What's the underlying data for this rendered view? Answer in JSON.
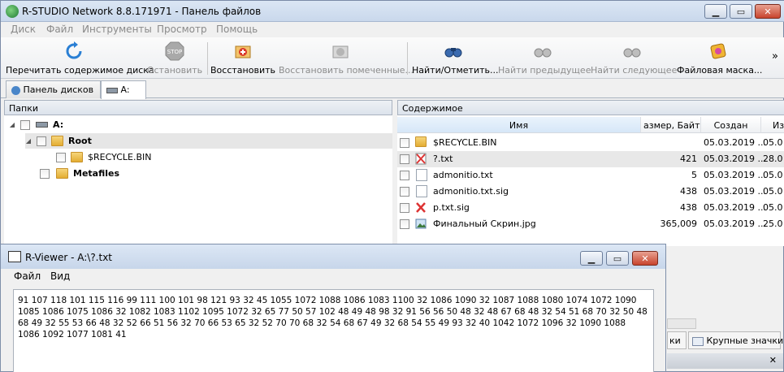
{
  "window": {
    "title": "R-STUDIO Network 8.8.171971 - Панель файлов",
    "minimize": "▁",
    "maximize": "▭",
    "close": "✕"
  },
  "menu": [
    "Диск",
    "Файл",
    "Инструменты",
    "Просмотр",
    "Помощь"
  ],
  "toolbar": {
    "rescan": "Перечитать содержимое диска",
    "stop": "Остановить",
    "recover": "Восстановить",
    "recover_marked": "Восстановить помеченные...",
    "find_mark": "Найти/Отметить...",
    "find_prev": "Найти предыдущее",
    "find_next": "Найти следующее",
    "file_mask": "Файловая маска...",
    "more": "»",
    "stop_icon_text": "STOP"
  },
  "tabs": {
    "disks": "Панель дисков",
    "drive": "A:"
  },
  "folders_panel": {
    "header": "Папки",
    "items": [
      {
        "label": "A:"
      },
      {
        "label": "Root"
      },
      {
        "label": "$RECYCLE.BIN"
      },
      {
        "label": "Metafiles"
      }
    ]
  },
  "contents_panel": {
    "header": "Содержимое",
    "columns": [
      "Имя",
      "азмер, Байты",
      "Создан",
      "Из"
    ],
    "rows": [
      {
        "name": "$RECYCLE.BIN",
        "size": "",
        "created": "05.03.2019 ...",
        "mod": "05.0"
      },
      {
        "name": "?.txt",
        "size": "421",
        "created": "05.03.2019 ...",
        "mod": "28.0"
      },
      {
        "name": "admonitio.txt",
        "size": "5",
        "created": "05.03.2019 ...",
        "mod": "05.0"
      },
      {
        "name": "admonitio.txt.sig",
        "size": "438",
        "created": "05.03.2019 ...",
        "mod": "05.0"
      },
      {
        "name": "p.txt.sig",
        "size": "438",
        "created": "05.03.2019 ...",
        "mod": "05.0"
      },
      {
        "name": "Финальный Скрин.jpg",
        "size": "365,009",
        "created": "05.03.2019 ...",
        "mod": "25.0"
      }
    ]
  },
  "right_bottom": {
    "small_icons_partial": "ки",
    "large_icons": "Крупные значки",
    "close": "✕"
  },
  "viewer": {
    "title": "R-Viewer - A:\\?.txt",
    "menu": [
      "Файл",
      "Вид"
    ],
    "content": "91 107 118 101 115 116 99 111 100 101 98 121 93 32 45 1055 1072 1088 1086 1083 1100 32 1086 1090 32 1087 1088 1080 1074 1072 1090 1085 1086 1075 1086 32 1082 1083 1102 1095 1072 32 65 77 50 57 102 48 49 48 98 32 91 56 56 50 48 32 48 67 68 48 32 54 51 68 70 32 50 48 68 49 32 55 53 66 48 32 52 66 51 56 32 70 66 53 65 32 52 70 70 68 32 54 68 67 49 32 68 54 55 49 93 32 40 1042 1072 1096 32 1090 1088 1086 1092 1077 1081 41"
  },
  "colors": {
    "accent": "#3399ff",
    "titlebar": "#c9d8ec",
    "close_btn": "#c8442d"
  }
}
